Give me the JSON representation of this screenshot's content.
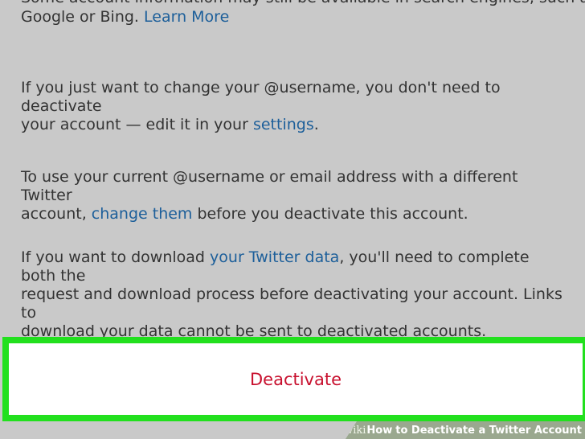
{
  "paragraphs": {
    "search_note": {
      "line_cut": "Some account information may still be available in search engines, such as",
      "line_2": "Google or Bing. ",
      "link": "Learn More"
    },
    "username": {
      "line_1": "If you just want to change your @username, you don't need to deactivate",
      "line_2_prefix": "your account — edit it in your ",
      "link": "settings",
      "line_2_suffix": "."
    },
    "email": {
      "line_1": "To use your current @username or email address with a different Twitter",
      "line_2_prefix": "account, ",
      "link": "change them",
      "line_2_suffix": " before you deactivate this account."
    },
    "download": {
      "line_1_prefix": "If you want to download ",
      "link": "your Twitter data",
      "line_1_suffix": ", you'll need to complete both the",
      "line_2": "request and download process before deactivating your account. Links to",
      "line_3": "download your data cannot be sent to deactivated accounts."
    }
  },
  "deactivate_button": {
    "label": "Deactivate"
  },
  "watermark": {
    "wiki": "wiki",
    "how": "How",
    "rest": "to Deactivate a Twitter Account"
  },
  "colors": {
    "background": "#c9c9c9",
    "text": "#333333",
    "link": "#1d5f9a",
    "highlight_border": "#22e01e",
    "deactivate_text": "#c8102e",
    "watermark_bg": "#9aa88f"
  }
}
